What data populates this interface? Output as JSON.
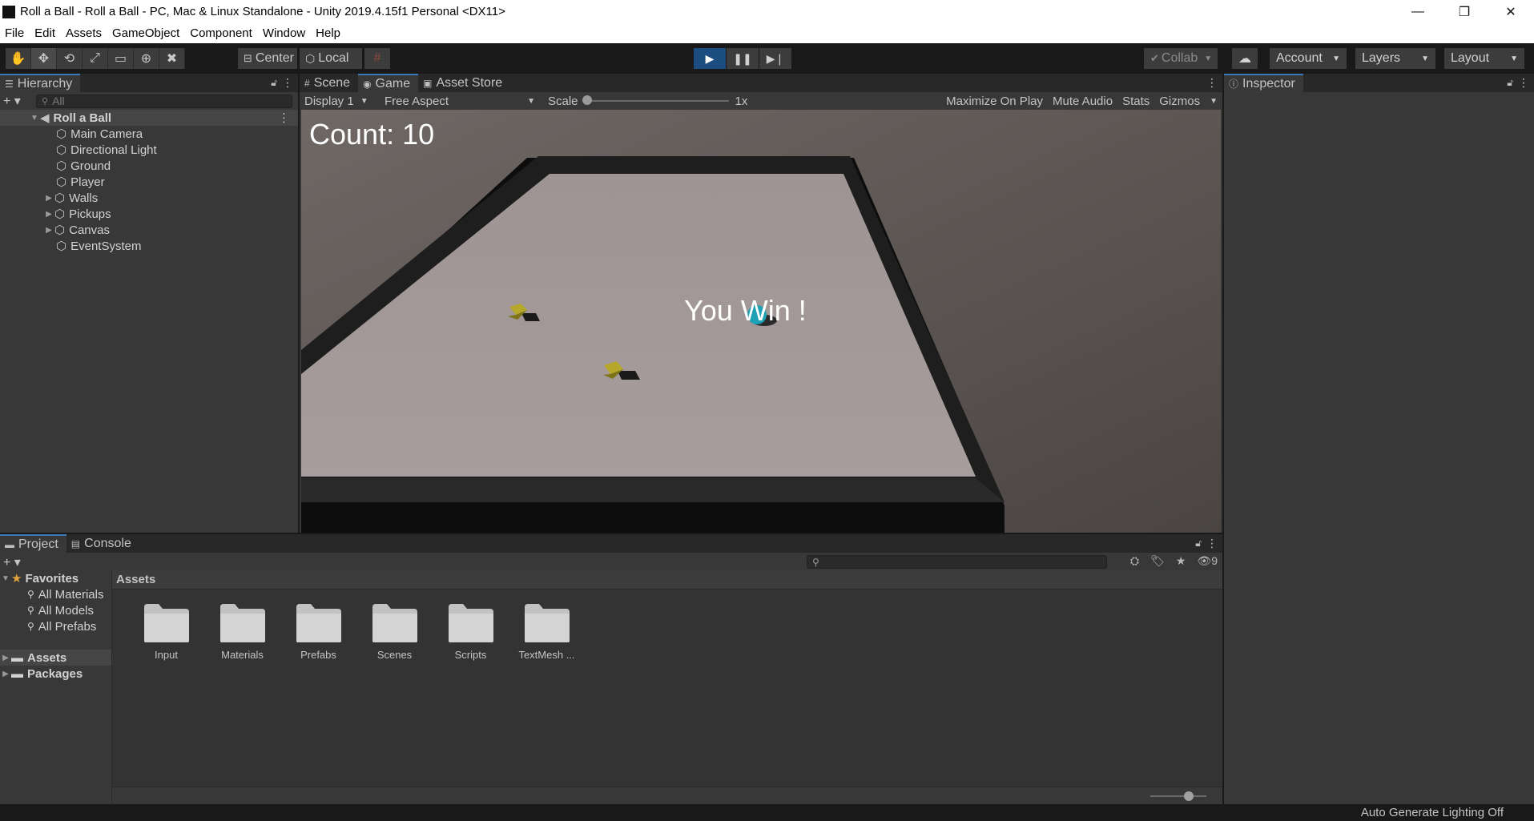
{
  "window": {
    "title": "Roll a Ball - Roll a Ball - PC, Mac & Linux Standalone - Unity 2019.4.15f1 Personal <DX11>"
  },
  "menu": [
    "File",
    "Edit",
    "Assets",
    "GameObject",
    "Component",
    "Window",
    "Help"
  ],
  "toolbar": {
    "pivot_label": "Center",
    "space_label": "Local",
    "collab_label": "Collab",
    "account_label": "Account",
    "layers_label": "Layers",
    "layout_label": "Layout"
  },
  "hierarchy": {
    "tab_label": "Hierarchy",
    "search_placeholder": "All",
    "scene_name": "Roll a Ball",
    "items": [
      "Main Camera",
      "Directional Light",
      "Ground",
      "Player",
      "Walls",
      "Pickups",
      "Canvas",
      "EventSystem"
    ]
  },
  "center_tabs": {
    "scene": "Scene",
    "game": "Game",
    "asset_store": "Asset Store"
  },
  "game_toolbar": {
    "display": "Display 1",
    "aspect": "Free Aspect",
    "scale_label": "Scale",
    "scale_value": "1x",
    "maximize": "Maximize On Play",
    "mute": "Mute Audio",
    "stats": "Stats",
    "gizmos": "Gizmos"
  },
  "game_view": {
    "count_text": "Count: 10",
    "win_text": "You Win !"
  },
  "inspector": {
    "tab_label": "Inspector"
  },
  "bottom_tabs": {
    "project": "Project",
    "console": "Console"
  },
  "project": {
    "hidden_count": "9",
    "favorites_label": "Favorites",
    "favorites": [
      "All Materials",
      "All Models",
      "All Prefabs"
    ],
    "assets_label": "Assets",
    "packages_label": "Packages",
    "breadcrumb": "Assets",
    "folders": [
      "Input",
      "Materials",
      "Prefabs",
      "Scenes",
      "Scripts",
      "TextMesh ..."
    ]
  },
  "status": {
    "text": "Auto Generate Lighting Off"
  },
  "colors": {
    "accent": "#3a79bb",
    "play_active": "#1c4d80",
    "background": "#383838"
  }
}
